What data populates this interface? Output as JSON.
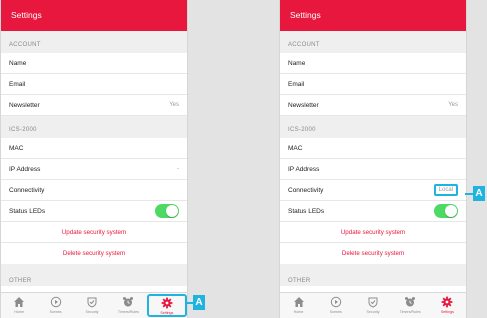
{
  "screens": [
    {
      "title": "Settings",
      "sections": {
        "account": "ACCOUNT",
        "ics": "ICS-2000",
        "other": "OTHER"
      },
      "rows": {
        "name": "Name",
        "email": "Email",
        "newsletter": "Newsletter",
        "newsletter_value": "Yes",
        "mac": "MAC",
        "ip": "IP Address",
        "ip_value": "-",
        "connectivity": "Connectivity",
        "connectivity_value": "",
        "status_leds": "Status LEDs"
      },
      "status_leds_on": true,
      "actions": {
        "update": "Update security system",
        "delete": "Delete security system"
      },
      "tabs": [
        "Home",
        "Scenes",
        "Security",
        "Timers/Rules",
        "Settings"
      ],
      "active_tab": "Settings"
    },
    {
      "title": "Settings",
      "sections": {
        "account": "ACCOUNT",
        "ics": "ICS-2000",
        "other": "OTHER"
      },
      "rows": {
        "name": "Name",
        "email": "Email",
        "newsletter": "Newsletter",
        "newsletter_value": "Yes",
        "mac": "MAC",
        "ip": "IP Address",
        "ip_value": "",
        "connectivity": "Connectivity",
        "connectivity_value": "Local",
        "status_leds": "Status LEDs"
      },
      "status_leds_on": true,
      "actions": {
        "update": "Update security system",
        "delete": "Delete security system"
      },
      "tabs": [
        "Home",
        "Scenes",
        "Security",
        "Timers/Rules",
        "Settings"
      ],
      "active_tab": "Settings"
    }
  ],
  "callouts": [
    "A",
    "A"
  ],
  "colors": {
    "accent": "#e8173d",
    "callout": "#1fb4e0",
    "toggle_on": "#4cd964"
  }
}
